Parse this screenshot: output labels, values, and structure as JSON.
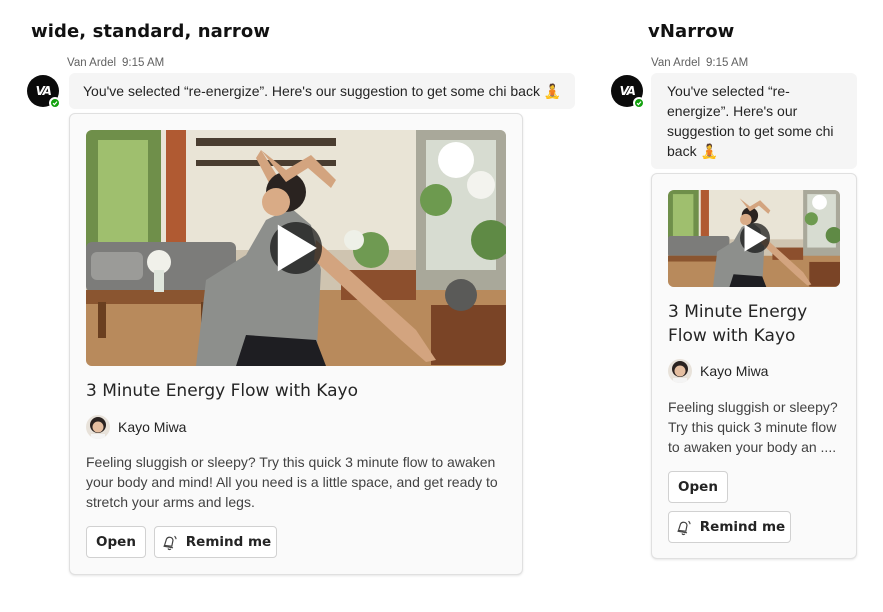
{
  "sections": {
    "left_title": "wide, standard, narrow",
    "right_title": "vNarrow"
  },
  "message": {
    "sender": "Van Ardel",
    "time": "9:15 AM",
    "avatar_initials": "VA",
    "presence": "available",
    "text": "You've selected “re-energize”.  Here's our suggestion to get some chi back 🧘"
  },
  "card": {
    "title": "3 Minute Energy Flow with Kayo",
    "author": "Kayo Miwa",
    "description": "Feeling sluggish or sleepy? Try this quick 3 minute flow to awaken your body and mind! All you need is a little space, and get ready to stretch your arms and legs.",
    "description_truncated": "Feeling sluggish or sleepy? Try this quick 3 minute flow to awaken your body an ....",
    "open_label": "Open",
    "remind_label": "Remind me"
  },
  "icons": {
    "play": "play-icon",
    "remind": "remind-bell-icon",
    "presence": "presence-available-icon"
  },
  "colors": {
    "presence_available": "#13a10e",
    "bubble_bg": "#f5f5f5",
    "card_bg": "#fafafa"
  }
}
